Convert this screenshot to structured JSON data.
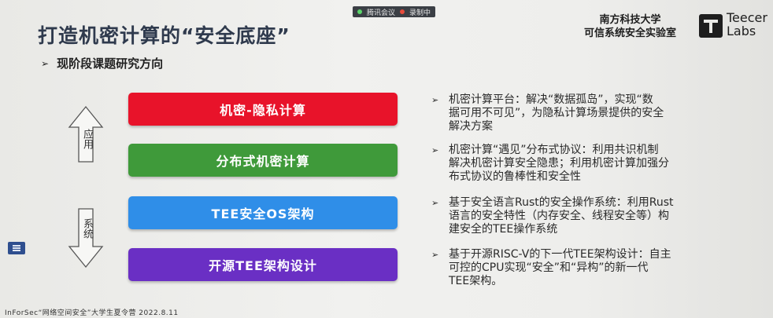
{
  "meeting": {
    "app": "腾讯会议",
    "recording": "录制中"
  },
  "slide": {
    "title": "打造机密计算的“安全底座”",
    "org_line1": "南方科技大学",
    "org_line2": "可信系统安全实验室",
    "logo_line1": "Teecer",
    "logo_line2": "Labs",
    "subtitle_marker": "➢",
    "subtitle": "现阶段课题研究方向",
    "axis_top": "应用",
    "axis_bottom": "系统",
    "bars": [
      {
        "label": "机密-隐私计算",
        "color": "#e8132a"
      },
      {
        "label": "分布式机密计算",
        "color": "#3f9a3a"
      },
      {
        "label": "TEE安全OS架构",
        "color": "#2f8ee8"
      },
      {
        "label": "开源TEE架构设计",
        "color": "#6a2fc4"
      }
    ],
    "bullet_marker": "➢",
    "bullets": [
      {
        "line1": "机密计算平台：解决“数据孤岛”，实现“数",
        "line2": "据可用不可见”，为隐私计算场景提供的安全",
        "line3": "解决方案"
      },
      {
        "line1": "机密计算“遇见”分布式协议：利用共识机制",
        "line2": "解决机密计算安全隐患；利用机密计算加强分",
        "line3": "布式协议的鲁棒性和安全性"
      },
      {
        "line1": "基于安全语言Rust的安全操作系统：利用Rust",
        "line2": "语言的安全特性（内存安全、线程安全等）构",
        "line3": "建安全的TEE操作系统"
      },
      {
        "line1": "基于开源RISC-V的下一代TEE架构设计：自主",
        "line2": "可控的CPU实现“安全”和“异构”的新一代",
        "line3": "TEE架构。"
      }
    ],
    "footer": "InForSec“网络空间安全”大学生夏令营 2022.8.11"
  },
  "icons": {
    "menu": "menu-icon",
    "up_arrow": "up-arrow-icon",
    "down_arrow": "down-arrow-icon"
  }
}
